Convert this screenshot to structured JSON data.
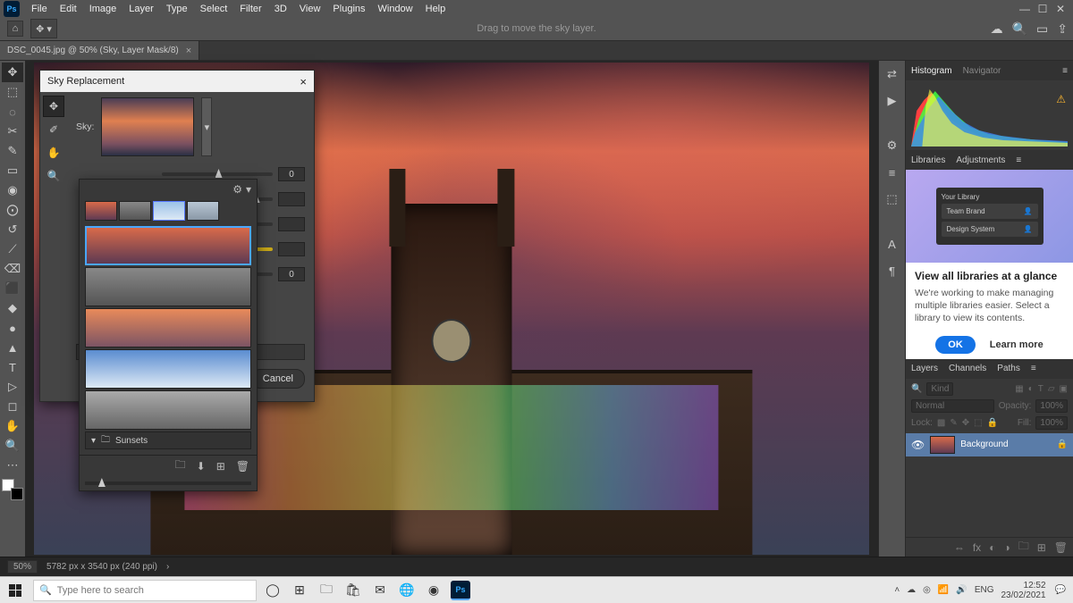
{
  "menubar": {
    "logo": "Ps",
    "items": [
      "File",
      "Edit",
      "Image",
      "Layer",
      "Type",
      "Select",
      "Filter",
      "3D",
      "View",
      "Plugins",
      "Window",
      "Help"
    ]
  },
  "optionsbar": {
    "hint": "Drag to move the sky layer."
  },
  "tab": {
    "title": "DSC_0045.jpg @ 50% (Sky, Layer Mask/8)",
    "close": "×"
  },
  "tools": {
    "left": [
      "✥",
      "⬚",
      "◌",
      "✂",
      "✎",
      "▭",
      "◉",
      "⨀",
      "↺",
      "⟋",
      "⌫",
      "⬛",
      "◆",
      "●",
      "▲",
      "✐",
      "T",
      "▷",
      "◻",
      "✋",
      "🔍"
    ]
  },
  "collapsed_strip": [
    "⇄",
    "▶",
    "⚙",
    "≡",
    "⬚",
    "A",
    "¶"
  ],
  "histogram_tabs": {
    "histogram": "Histogram",
    "navigator": "Navigator"
  },
  "lib_tabs": {
    "libraries": "Libraries",
    "adjustments": "Adjustments"
  },
  "lib_promo": {
    "mock_title": "Your Library",
    "mock_row1": "Team Brand",
    "mock_row2": "Design System",
    "title": "View all libraries at a glance",
    "body": "We're working to make managing multiple libraries easier. Select a library to view its contents.",
    "ok": "OK",
    "learn": "Learn more"
  },
  "layers_tabs": {
    "layers": "Layers",
    "channels": "Channels",
    "paths": "Paths"
  },
  "layers": {
    "kind_search": "Kind",
    "blend": "Normal",
    "opacity_label": "Opacity:",
    "opacity_val": "100%",
    "lock_label": "Lock:",
    "fill_label": "Fill:",
    "fill_val": "100%",
    "bg_name": "Background"
  },
  "sky_panel": {
    "title": "Sky Replacement",
    "close": "×",
    "sky_label": "Sky:",
    "slider_vals": [
      "0",
      "",
      "0"
    ],
    "cancel": "Cancel"
  },
  "sky_flyout": {
    "folder_name": "Sunsets"
  },
  "statusbar": {
    "zoom": "50%",
    "docinfo": "5782 px x 3540 px (240 ppi)"
  },
  "taskbar": {
    "search_placeholder": "Type here to search",
    "lang": "ENG",
    "time": "12:52",
    "date": "23/02/2021"
  }
}
